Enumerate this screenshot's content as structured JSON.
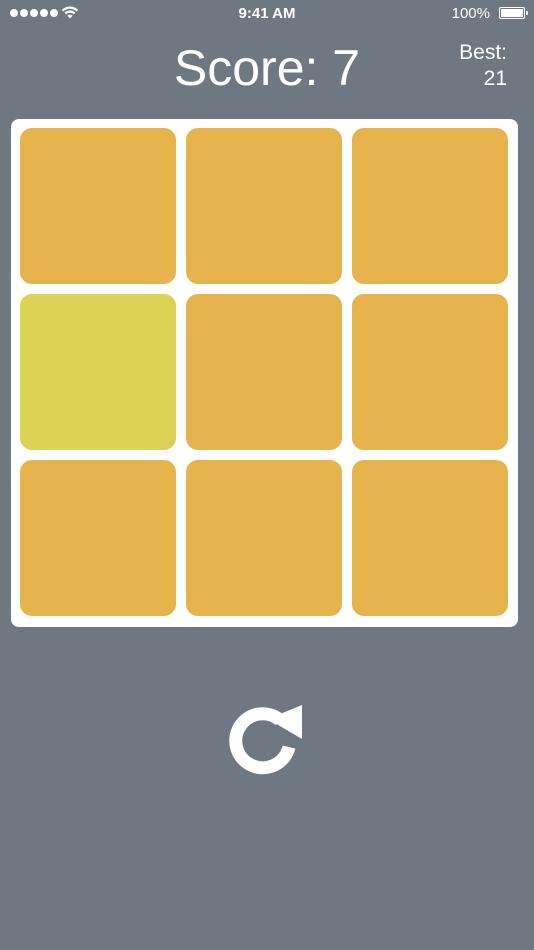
{
  "status_bar": {
    "time": "9:41 AM",
    "battery": "100%",
    "signal_icon": "signal-dots-icon",
    "wifi_icon": "wifi-icon",
    "battery_icon": "battery-icon"
  },
  "header": {
    "score": "Score: 7",
    "best_label": "Best:",
    "best_value": "21"
  },
  "board": {
    "rows": 3,
    "cols": 3,
    "tiles": [
      {
        "row": 0,
        "col": 0,
        "color": "#e7b34d"
      },
      {
        "row": 0,
        "col": 1,
        "color": "#e7b34d"
      },
      {
        "row": 0,
        "col": 2,
        "color": "#e7b34d"
      },
      {
        "row": 1,
        "col": 0,
        "color": "#dbd155"
      },
      {
        "row": 1,
        "col": 1,
        "color": "#e7b34d"
      },
      {
        "row": 1,
        "col": 2,
        "color": "#e7b34d"
      },
      {
        "row": 2,
        "col": 0,
        "color": "#e7b34d"
      },
      {
        "row": 2,
        "col": 1,
        "color": "#e7b34d"
      },
      {
        "row": 2,
        "col": 2,
        "color": "#e7b34d"
      }
    ]
  },
  "controls": {
    "restart_icon": "restart-icon"
  },
  "colors": {
    "background": "#6e7883",
    "board": "#ffffff",
    "tile": "#e7b34d",
    "odd_tile": "#dbd155",
    "text": "#ffffff"
  }
}
